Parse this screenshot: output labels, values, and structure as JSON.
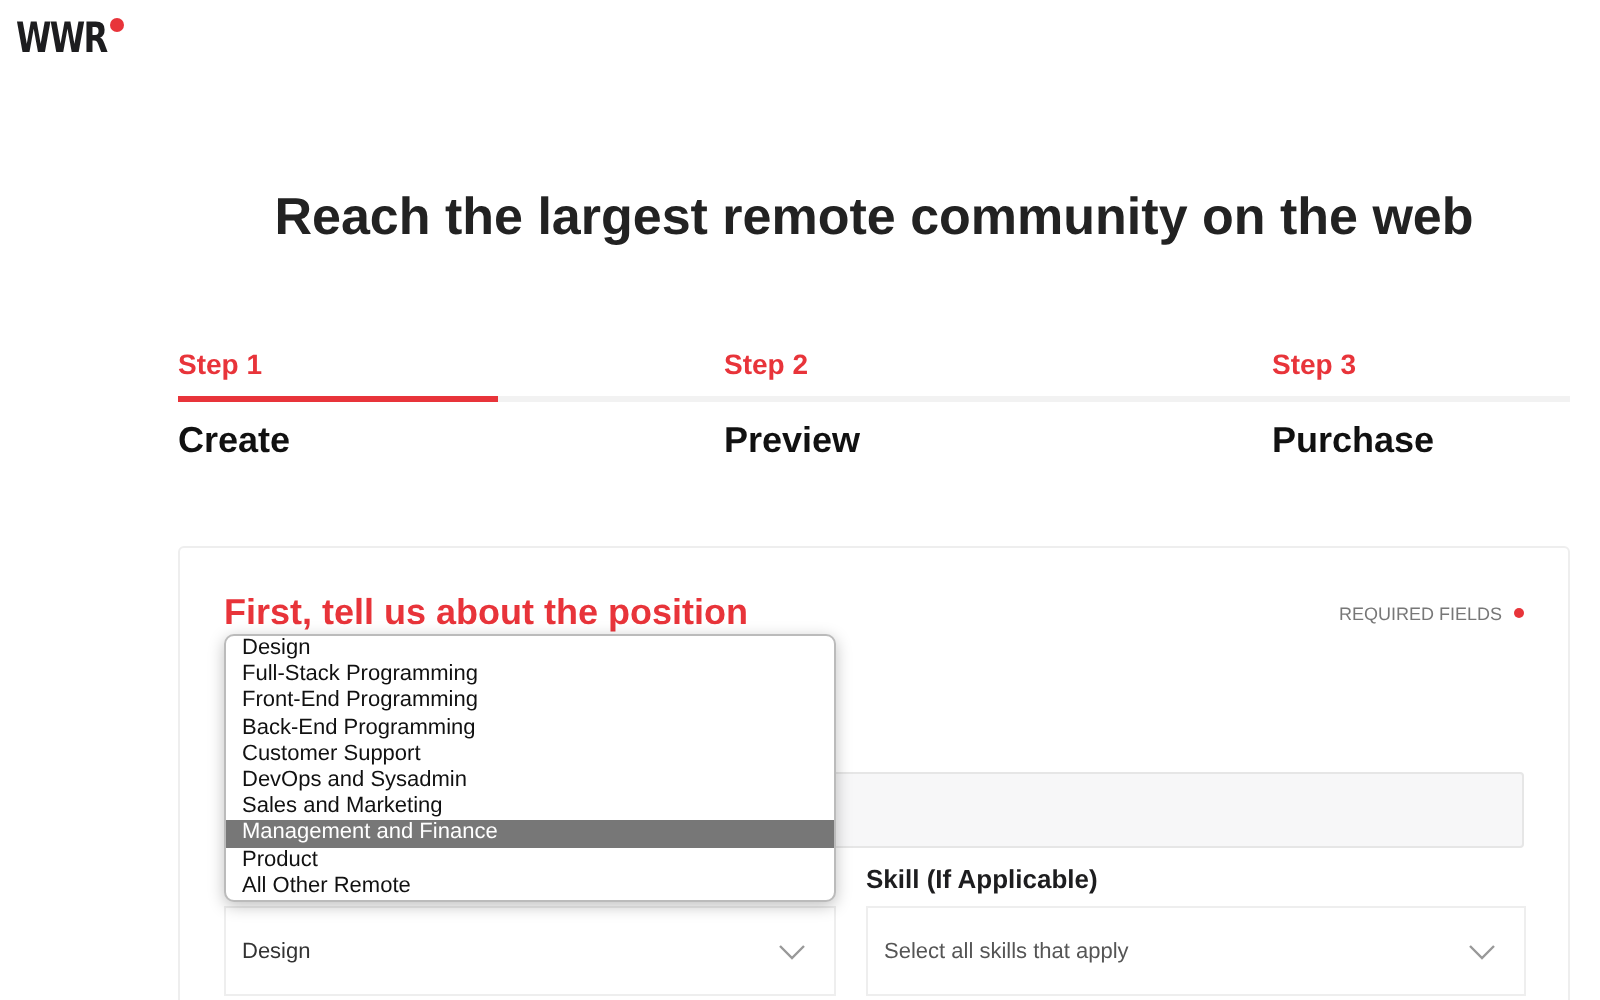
{
  "logo": {
    "text": "WWR"
  },
  "heading": "Reach the largest remote community on the web",
  "steps": [
    {
      "label": "Step 1",
      "title": "Create",
      "selected": true
    },
    {
      "label": "Step 2",
      "title": "Preview",
      "selected": false
    },
    {
      "label": "Step 3",
      "title": "Purchase",
      "selected": false
    }
  ],
  "form": {
    "title": "First, tell us about the position",
    "required_note": "REQUIRED FIELDS",
    "category_select": {
      "value": "Design",
      "expanded": true,
      "options": [
        {
          "label": "Design",
          "highlighted": false
        },
        {
          "label": "Full-Stack Programming",
          "highlighted": false
        },
        {
          "label": "Front-End Programming",
          "highlighted": false
        },
        {
          "label": "Back-End Programming",
          "highlighted": false
        },
        {
          "label": "Customer Support",
          "highlighted": false
        },
        {
          "label": "DevOps and Sysadmin",
          "highlighted": false
        },
        {
          "label": "Sales and Marketing",
          "highlighted": false
        },
        {
          "label": "Management and Finance",
          "highlighted": true
        },
        {
          "label": "Product",
          "highlighted": false
        },
        {
          "label": "All Other Remote",
          "highlighted": false
        }
      ]
    },
    "skill": {
      "label": "Skill (If Applicable)",
      "placeholder": "Select all skills that apply"
    }
  }
}
